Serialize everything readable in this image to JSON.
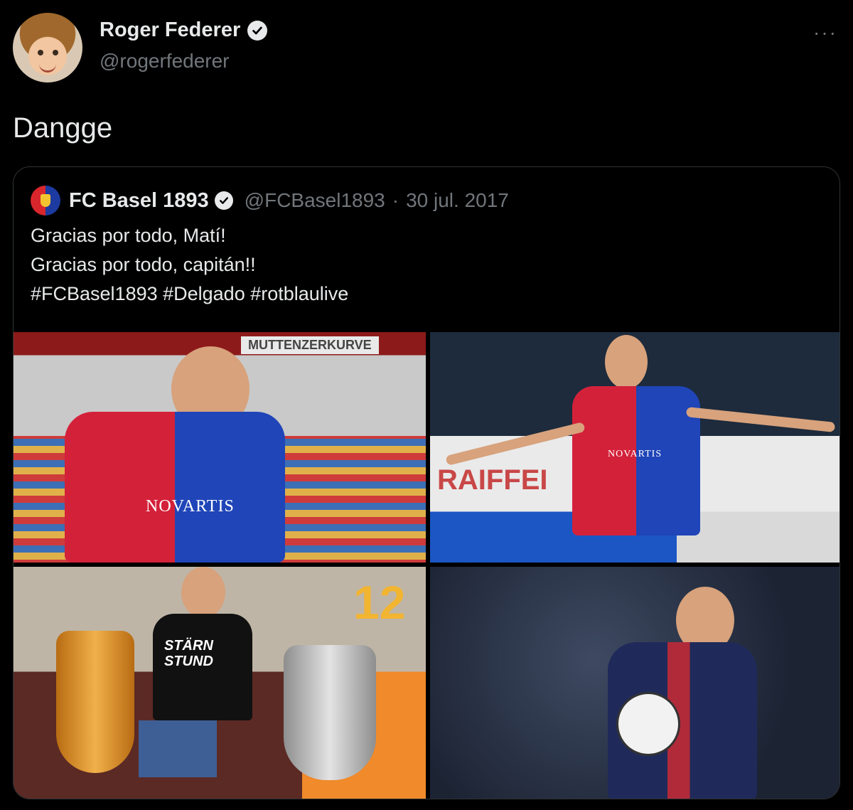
{
  "tweet": {
    "author_name": "Roger Federer",
    "author_handle": "@rogerfederer",
    "more_icon": "more-horizontal-icon",
    "text": "Dangge"
  },
  "quoted": {
    "author_name": "FC Basel 1893",
    "author_handle": "@FCBasel1893",
    "separator": "·",
    "date": "30 jul. 2017",
    "lines": [
      "Gracias por todo, Matí!",
      "Gracias por todo, capitán!!",
      "#FCBasel1893 #Delgado #rotblaulive"
    ],
    "photo_texts": {
      "stadium_banner": "MUTTENZERKURVE",
      "shirt_sponsor": "NOVARTIS",
      "tee_text_1": "STÄRN",
      "tee_text_2": "STUND",
      "board_text": "RAIFFEI",
      "number": "12"
    }
  },
  "colors": {
    "background": "#000000",
    "text": "#e7e9ea",
    "secondary": "#71767b",
    "border": "#2f3336"
  }
}
